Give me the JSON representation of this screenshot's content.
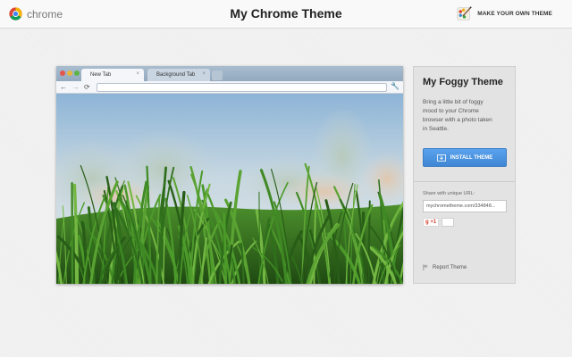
{
  "header": {
    "brand": "chrome",
    "title": "My Chrome Theme",
    "make_own": "MAKE YOUR OWN THEME"
  },
  "preview": {
    "tabs": [
      {
        "label": "New Tab",
        "close": "×"
      },
      {
        "label": "Background Tab",
        "close": "×"
      }
    ],
    "nav": {
      "back": "←",
      "forward": "→",
      "reload": "⟳",
      "wrench": "🔧"
    }
  },
  "panel": {
    "theme_name": "My Foggy Theme",
    "description": "Bring a little bit of foggy mood to your Chrome browser with a photo taken in Seattle.",
    "install_label": "INSTALL THEME",
    "share_label": "Share with unique URL:",
    "share_url": "mychrometheme.com/334848...",
    "plus_one": "+1",
    "report": "Report Theme"
  },
  "colors": {
    "accent": "#4a92e0",
    "sky_top": "#8fb4d4",
    "grass": "#3f8a24"
  },
  "icons": [
    "chrome-logo-icon",
    "palette-icon",
    "install-icon",
    "flag-icon"
  ]
}
